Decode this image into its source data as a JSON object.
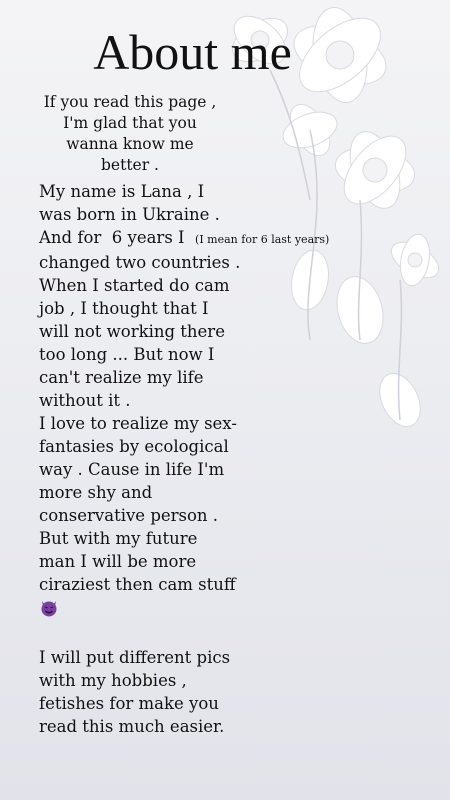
{
  "title": "About me",
  "intro": "If you read this page ,\nI'm glad that you\nwanna know me\nbetter .",
  "body": {
    "line1": "My name is Lana , I",
    "line2": "was born in Ukraine .",
    "line3a": "And for  6 years I  ",
    "line3b": "(I mean for 6 last years)",
    "rest": "changed two countries .\nWhen I started do cam\njob , I thought that I\nwill not working there\ntoo long ... But now I\ncan't realize my life\nwithout it .\nI love to realize my sex-\nfantasies by ecological\nway . Cause in life I'm\nmore shy and\nconservative person .\nBut with my future\nman I will be more\nciraziest then cam stuff"
  },
  "emoji": "smiling-devil-icon",
  "outro": "I will put different pics\nwith my hobbies ,\nfetishes for make you\nread this much easier.",
  "colors": {
    "background": "#ecedf1",
    "emoji": "#7b3fa0",
    "text": "#111111"
  }
}
